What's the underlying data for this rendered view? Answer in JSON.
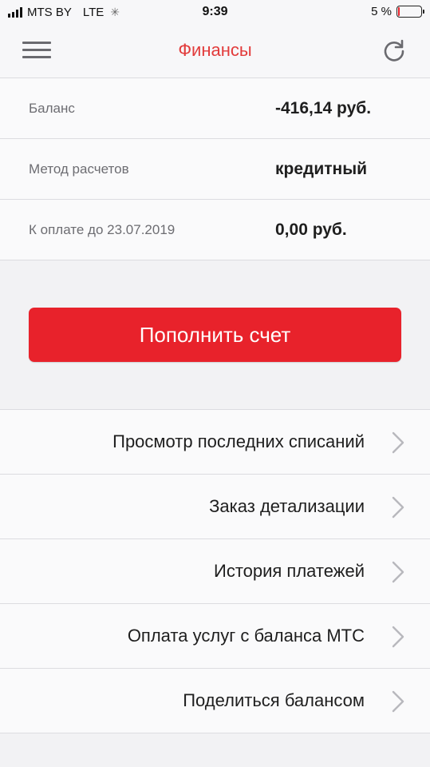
{
  "status_bar": {
    "carrier": "MTS BY",
    "network": "LTE",
    "time": "9:39",
    "battery_percent": "5 %",
    "battery_color": "#e8222b"
  },
  "nav": {
    "title": "Финансы",
    "title_color": "#e23b3b",
    "left_icon": "hamburger-menu-icon",
    "right_icon": "refresh-icon"
  },
  "info": [
    {
      "label": "Баланс",
      "value": "-416,14 руб."
    },
    {
      "label": "Метод расчетов",
      "value": "кредитный"
    },
    {
      "label": "К оплате до 23.07.2019",
      "value": "0,00 руб."
    }
  ],
  "topup_button": {
    "label": "Пополнить счет",
    "color": "#e8222b"
  },
  "menu": [
    {
      "label": "Просмотр последних списаний",
      "icon": "chevron-right-icon"
    },
    {
      "label": "Заказ детализации",
      "icon": "chevron-right-icon"
    },
    {
      "label": "История платежей",
      "icon": "chevron-right-icon"
    },
    {
      "label": "Оплата услуг с баланса МТС",
      "icon": "chevron-right-icon"
    },
    {
      "label": "Поделиться балансом",
      "icon": "chevron-right-icon"
    }
  ]
}
